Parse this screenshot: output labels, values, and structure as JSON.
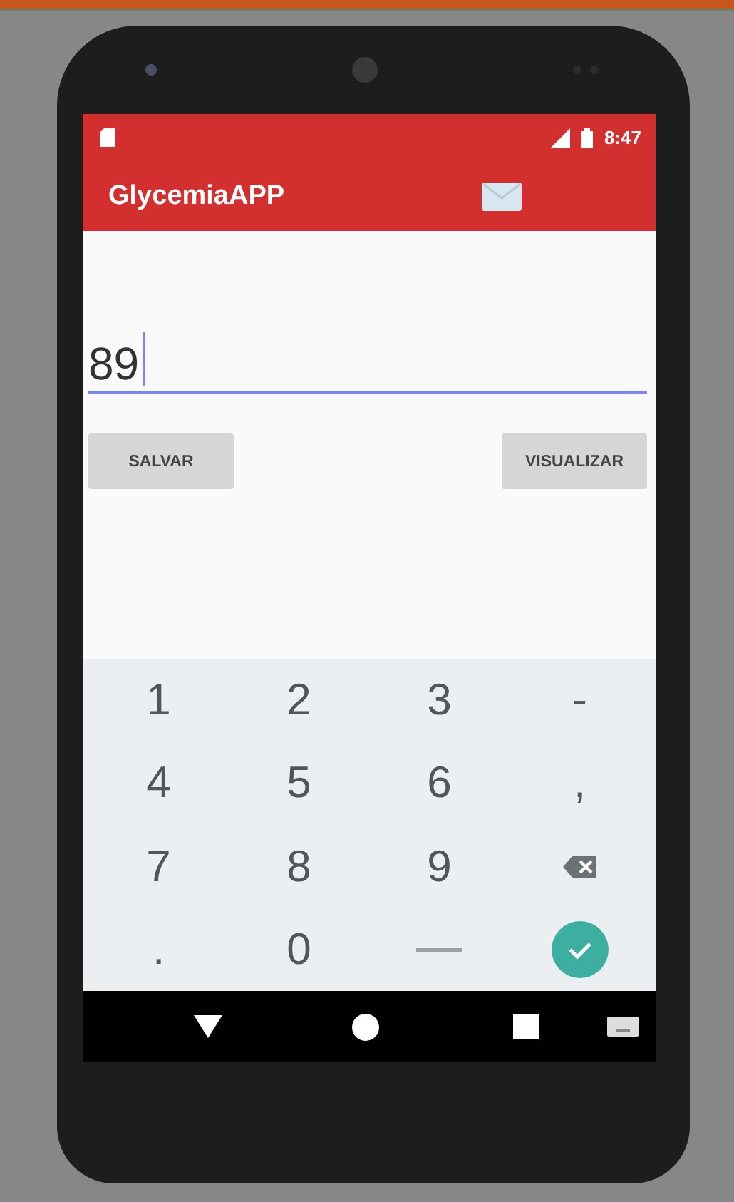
{
  "status_bar": {
    "time": "8:47"
  },
  "toolbar": {
    "title": "GlycemiaAPP"
  },
  "glucose_field": {
    "value": "89",
    "focused": true
  },
  "buttons": [
    {
      "label": "SALVAR"
    },
    {
      "label": "VISUALIZAR"
    }
  ],
  "keyboard": {
    "keys": [
      {
        "kind": "char",
        "label": "1"
      },
      {
        "kind": "char",
        "label": "2"
      },
      {
        "kind": "char",
        "label": "3"
      },
      {
        "kind": "char",
        "label": "-"
      },
      {
        "kind": "char",
        "label": "4"
      },
      {
        "kind": "char",
        "label": "5"
      },
      {
        "kind": "char",
        "label": "6"
      },
      {
        "kind": "char",
        "label": ","
      },
      {
        "kind": "char",
        "label": "7"
      },
      {
        "kind": "char",
        "label": "8"
      },
      {
        "kind": "char",
        "label": "9"
      },
      {
        "kind": "backspace"
      },
      {
        "kind": "char",
        "label": "."
      },
      {
        "kind": "char",
        "label": "0"
      },
      {
        "kind": "space"
      },
      {
        "kind": "done"
      }
    ]
  }
}
